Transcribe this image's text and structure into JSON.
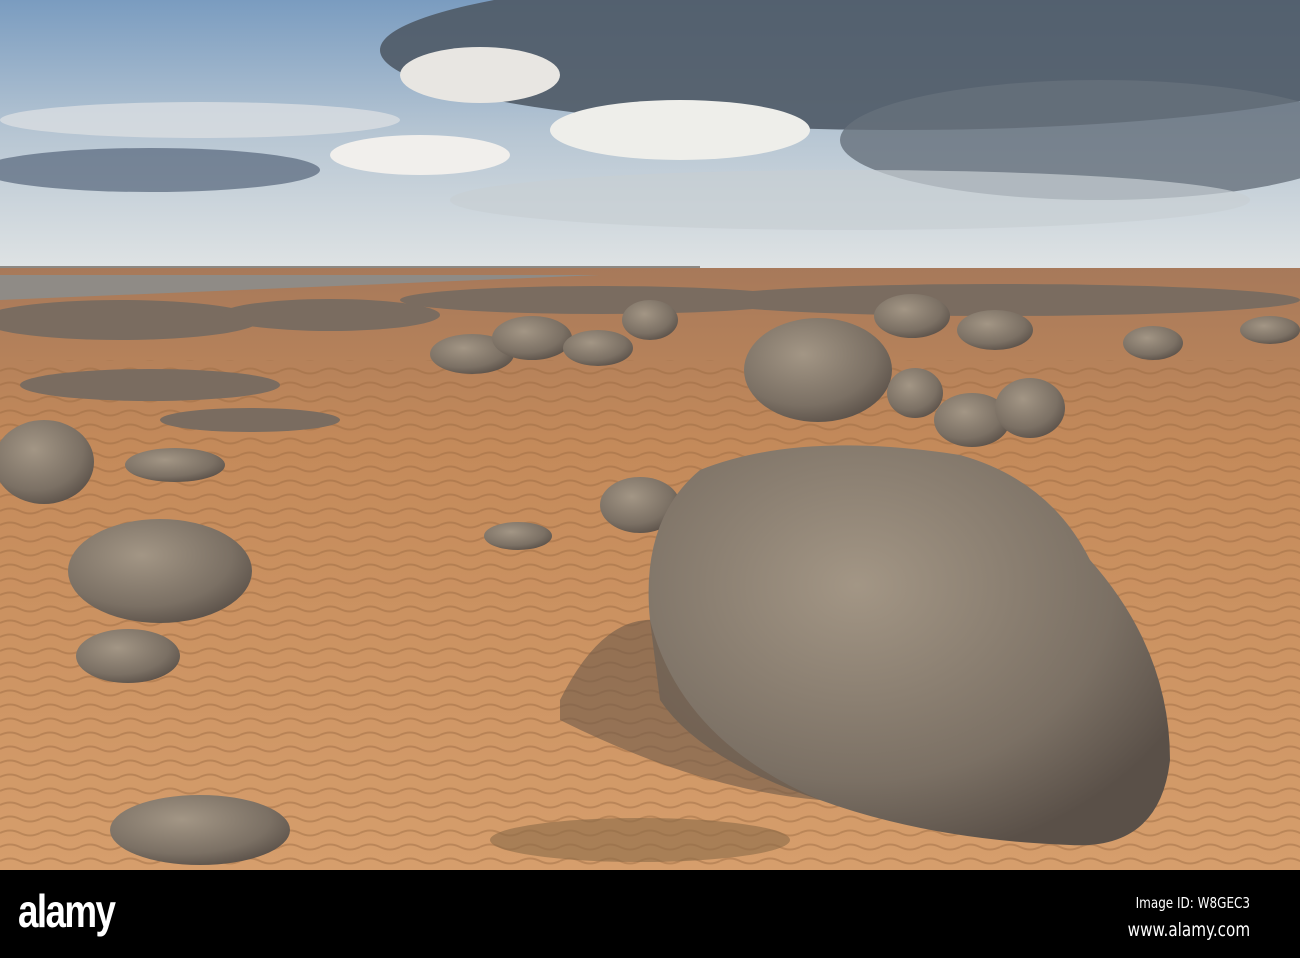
{
  "watermark": {
    "logo": "alamy",
    "image_id": "Image ID: W8GEC3",
    "url": "www.alamy.com"
  },
  "colors": {
    "sky_top": "#6f93b8",
    "cloud_dark": "#4d5863",
    "sand": "#c98e5c",
    "boulder": "#7d7266",
    "sea": "#8a8a86"
  }
}
